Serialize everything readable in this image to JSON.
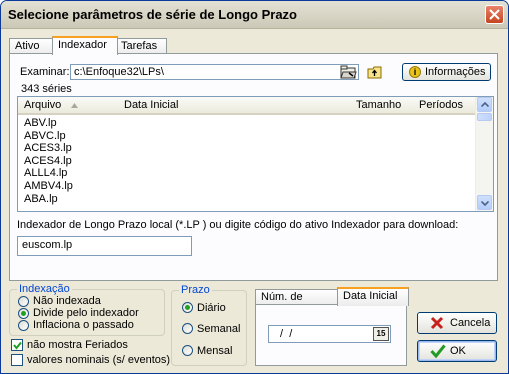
{
  "window": {
    "title": "Selecione parâmetros de série de Longo Prazo"
  },
  "tabs": [
    {
      "label": "Ativo"
    },
    {
      "label": "Indexador"
    },
    {
      "label": "Tarefas"
    }
  ],
  "browse": {
    "label": "Examinar:",
    "path": "c:\\Enfoque32\\LPs\\",
    "info_button": "Informações",
    "count": "343 séries"
  },
  "file_list": {
    "columns": [
      "Arquivo",
      "Data Inicial",
      "Tamanho",
      "Períodos"
    ],
    "rows": [
      "ABV.lp",
      "ABVC.lp",
      "ACES3.lp",
      "ACES4.lp",
      "ALLL4.lp",
      "AMBV4.lp",
      "ABA.lp"
    ]
  },
  "indexer": {
    "label": "Indexador de Longo Prazo local (*.LP )  ou digite código do ativo  Indexador para download:",
    "value": "euscom.lp"
  },
  "indexacao": {
    "legend": "Indexação",
    "options": [
      "Não indexada",
      "Divide pelo indexador",
      "Inflaciona o passado"
    ],
    "selected": 1
  },
  "checks": [
    {
      "label": "não mostra Feriados",
      "checked": true
    },
    {
      "label": "valores nominais (s/ eventos)",
      "checked": false
    }
  ],
  "prazo": {
    "legend": "Prazo",
    "options": [
      "Diário",
      "Semanal",
      "Mensal"
    ],
    "selected": 0
  },
  "subtabs": [
    {
      "label": "Núm. de barras"
    },
    {
      "label": "Data Inicial"
    }
  ],
  "date": {
    "value": " /  /",
    "cal_label": "15"
  },
  "buttons": {
    "cancel": "Cancela",
    "ok": "OK"
  },
  "colors": {
    "title_blue": "#0046d5",
    "active_tab_accent": "#f7a020",
    "close_red": "#c6451f"
  }
}
